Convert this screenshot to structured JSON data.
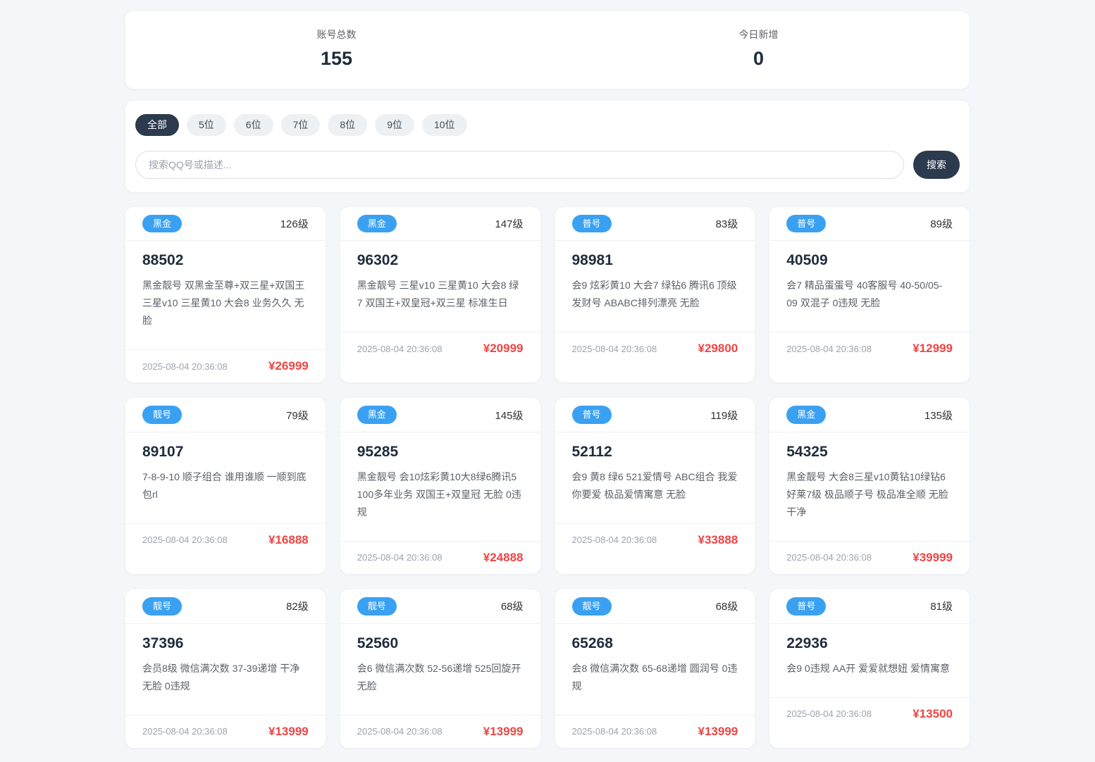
{
  "stats": {
    "total_label": "账号总数",
    "total_value": "155",
    "today_label": "今日新增",
    "today_value": "0"
  },
  "filters": {
    "tabs": [
      {
        "label": "全部",
        "active": true
      },
      {
        "label": "5位",
        "active": false
      },
      {
        "label": "6位",
        "active": false
      },
      {
        "label": "7位",
        "active": false
      },
      {
        "label": "8位",
        "active": false
      },
      {
        "label": "9位",
        "active": false
      },
      {
        "label": "10位",
        "active": false
      }
    ],
    "search_placeholder": "搜索QQ号或描述...",
    "search_button": "搜索"
  },
  "colors": {
    "badge_blue": "#3aa1f2",
    "accent_dark": "#2b3a4d",
    "price_red": "#ef4444",
    "page_background": "#f4f6f9"
  },
  "cards": [
    {
      "badge": "黑金",
      "level": "126级",
      "number": "88502",
      "desc": "黑金靓号 双黑金至尊+双三星+双国王 三星v10 三星黄10 大会8 业务久久 无脸",
      "date": "2025-08-04 20:36:08",
      "price": "¥26999"
    },
    {
      "badge": "黑金",
      "level": "147级",
      "number": "96302",
      "desc": "黑金靓号 三星v10 三星黄10 大会8 绿7 双国王+双皇冠+双三星 标准生日",
      "date": "2025-08-04 20:36:08",
      "price": "¥20999"
    },
    {
      "badge": "普号",
      "level": "83级",
      "number": "98981",
      "desc": "会9 炫彩黄10 大会7 绿钻6 腾讯6 顶级发财号 ABABC排列漂亮 无脸",
      "date": "2025-08-04 20:36:08",
      "price": "¥29800"
    },
    {
      "badge": "普号",
      "level": "89级",
      "number": "40509",
      "desc": "会7 精品蛋蛋号 40客服号 40-50/05-09 双混子 0违规 无脸",
      "date": "2025-08-04 20:36:08",
      "price": "¥12999"
    },
    {
      "badge": "靓号",
      "level": "79级",
      "number": "89107",
      "desc": "7-8-9-10 顺子组合 谁用谁顺 一顺到底 包rl",
      "date": "2025-08-04 20:36:08",
      "price": "¥16888"
    },
    {
      "badge": "黑金",
      "level": "145级",
      "number": "95285",
      "desc": "黑金靓号 会10炫彩黄10大8绿6腾讯5 100多年业务 双国王+双皇冠 无脸 0违规",
      "date": "2025-08-04 20:36:08",
      "price": "¥24888"
    },
    {
      "badge": "普号",
      "level": "119级",
      "number": "52112",
      "desc": "会9 黄8 绿6 521爱情号 ABC组合 我爱你要爱 极品爱情寓意 无脸",
      "date": "2025-08-04 20:36:08",
      "price": "¥33888"
    },
    {
      "badge": "黑金",
      "level": "135级",
      "number": "54325",
      "desc": "黑金靓号 大会8三星v10黄钻10绿钻6好莱7级 极品顺子号 极品准全顺 无脸干净",
      "date": "2025-08-04 20:36:08",
      "price": "¥39999"
    },
    {
      "badge": "靓号",
      "level": "82级",
      "number": "37396",
      "desc": "会员8级 微信满次数 37-39递增 干净 无脸 0违规",
      "date": "2025-08-04 20:36:08",
      "price": "¥13999"
    },
    {
      "badge": "靓号",
      "level": "68级",
      "number": "52560",
      "desc": "会6 微信满次数 52-56递增 525回旋开 无脸",
      "date": "2025-08-04 20:36:08",
      "price": "¥13999"
    },
    {
      "badge": "靓号",
      "level": "68级",
      "number": "65268",
      "desc": "会8 微信满次数 65-68递增 圆润号 0违规",
      "date": "2025-08-04 20:36:08",
      "price": "¥13999"
    },
    {
      "badge": "普号",
      "level": "81级",
      "number": "22936",
      "desc": "会9 0违规 AA开 爱爱就想妞 爱情寓意",
      "date": "2025-08-04 20:36:08",
      "price": "¥13500"
    }
  ]
}
